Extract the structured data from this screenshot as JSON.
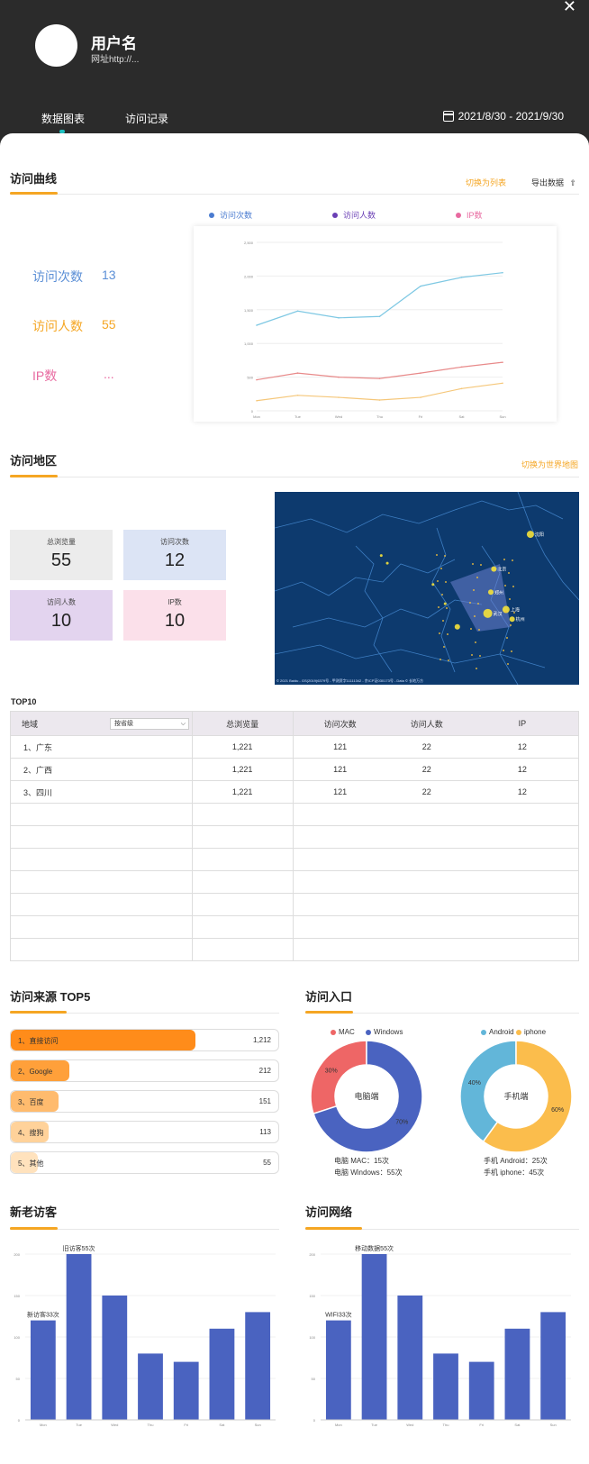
{
  "header": {
    "username": "用户名",
    "url": "网址http://...",
    "tabs": [
      "数据图表",
      "访问记录"
    ],
    "date_range": "2021/8/30 - 2021/9/30",
    "close": "✕"
  },
  "visit_curve": {
    "title": "访问曲线",
    "switch_link": "切换为列表",
    "export": "导出数据",
    "stats": [
      {
        "label": "访问次数",
        "value": "13",
        "color": "#5b8fd6"
      },
      {
        "label": "访问人数",
        "value": "55",
        "color": "#f5a623"
      },
      {
        "label": "IP数",
        "value": "...",
        "color": "#e86aa0"
      }
    ],
    "legend": [
      {
        "label": "访问次数",
        "color": "#4a7bd0"
      },
      {
        "label": "访问人数",
        "color": "#6a3fb5"
      },
      {
        "label": "IP数",
        "color": "#e86aa0"
      }
    ]
  },
  "chart_data": [
    {
      "type": "line",
      "categories": [
        "Mon",
        "Tue",
        "Wed",
        "Thu",
        "Fri",
        "Sat",
        "Sun"
      ],
      "ylim": [
        0,
        2500
      ],
      "yticks": [
        "0",
        "500",
        "1,000",
        "1,500",
        "2,000",
        "2,500"
      ],
      "series": [
        {
          "color": "#7ec8e3",
          "values": [
            1270,
            1480,
            1380,
            1400,
            1850,
            1980,
            2050
          ]
        },
        {
          "color": "#e88a8a",
          "values": [
            460,
            560,
            500,
            480,
            560,
            650,
            720
          ]
        },
        {
          "color": "#f5c77a",
          "values": [
            150,
            230,
            200,
            160,
            200,
            330,
            410
          ]
        }
      ]
    },
    {
      "type": "bar",
      "categories": [
        "Mon",
        "Tue",
        "Wed",
        "Thu",
        "Fri",
        "Sat",
        "Sun"
      ],
      "values": [
        120,
        200,
        150,
        80,
        70,
        110,
        130
      ],
      "ylim": [
        0,
        200
      ],
      "yticks": [
        "0",
        "50",
        "100",
        "150",
        "200"
      ],
      "annotations": [
        {
          "category": "Mon",
          "text": "新访客33次"
        },
        {
          "category": "Tue",
          "text": "旧访客55次"
        }
      ]
    },
    {
      "type": "bar",
      "categories": [
        "Mon",
        "Tue",
        "Wed",
        "Thu",
        "Fri",
        "Sat",
        "Sun"
      ],
      "values": [
        120,
        200,
        150,
        80,
        70,
        110,
        130
      ],
      "ylim": [
        0,
        200
      ],
      "yticks": [
        "0",
        "50",
        "100",
        "150",
        "200"
      ],
      "annotations": [
        {
          "category": "Mon",
          "text": "WIFI33次"
        },
        {
          "category": "Tue",
          "text": "移动数据55次"
        }
      ]
    },
    {
      "type": "pie",
      "title": "电脑端",
      "slices": [
        {
          "label": "MAC",
          "value": 30,
          "color": "#ee6666",
          "text": "30%"
        },
        {
          "label": "Windows",
          "value": 70,
          "color": "#4a63c0",
          "text": "70%"
        }
      ]
    },
    {
      "type": "pie",
      "title": "手机端",
      "slices": [
        {
          "label": "Android",
          "value": 40,
          "color": "#62b6d9",
          "text": "40%"
        },
        {
          "label": "iphone",
          "value": 60,
          "color": "#fbbd4c",
          "text": "60%"
        }
      ]
    }
  ],
  "region": {
    "title": "访问地区",
    "switch_link": "切换为世界地图",
    "cards": [
      {
        "label": "总浏览量",
        "value": "55",
        "color": "#ececec"
      },
      {
        "label": "访问次数",
        "value": "12",
        "color": "#dce4f5"
      },
      {
        "label": "访问人数",
        "value": "10",
        "color": "#e3d4ef"
      },
      {
        "label": "IP数",
        "value": "10",
        "color": "#fbe0ea"
      }
    ],
    "map_dots": [
      {
        "lon": 0.84,
        "lat": 0.22,
        "r": 4,
        "label": "沈阳"
      },
      {
        "lon": 0.72,
        "lat": 0.4,
        "r": 3,
        "label": "北京"
      },
      {
        "lon": 0.71,
        "lat": 0.52,
        "r": 3,
        "label": "郑州"
      },
      {
        "lon": 0.76,
        "lat": 0.61,
        "r": 4,
        "label": "上海"
      },
      {
        "lon": 0.7,
        "lat": 0.63,
        "r": 5,
        "label": "武汉"
      },
      {
        "lon": 0.78,
        "lat": 0.66,
        "r": 3,
        "label": "杭州"
      },
      {
        "lon": 0.6,
        "lat": 0.7,
        "r": 3,
        "label": ""
      },
      {
        "lon": 0.35,
        "lat": 0.33,
        "r": 1.5,
        "label": ""
      },
      {
        "lon": 0.37,
        "lat": 0.37,
        "r": 1.5,
        "label": ""
      },
      {
        "lon": 0.52,
        "lat": 0.48,
        "r": 1.5,
        "label": ""
      },
      {
        "lon": 0.56,
        "lat": 0.58,
        "r": 1.5,
        "label": ""
      }
    ],
    "map_footer": "© 2021 Baidu - GS(2019)6379号 - 甲测资字11111342 - 京ICP证030173号 - Data © 长地万方"
  },
  "top10": {
    "title": "TOP10",
    "select_value": "按省级",
    "headers": [
      "地域",
      "总浏览量",
      "访问次数",
      "访问人数",
      "IP"
    ],
    "rows": [
      [
        "1、广东",
        "1,221",
        "121",
        "22",
        "12"
      ],
      [
        "2、广西",
        "1,221",
        "121",
        "22",
        "12"
      ],
      [
        "3、四川",
        "1,221",
        "121",
        "22",
        "12"
      ]
    ],
    "empty_rows": 7
  },
  "sources": {
    "title": "访问来源 TOP5",
    "items": [
      {
        "label": "1、直接访问",
        "value": "1,212",
        "fill": 0.69,
        "color": "#ff8c1a"
      },
      {
        "label": "2、Google",
        "value": "212",
        "fill": 0.22,
        "color": "#ffa03a"
      },
      {
        "label": "3、百度",
        "value": "151",
        "fill": 0.18,
        "color": "#ffbb6e"
      },
      {
        "label": "4、搜狗",
        "value": "113",
        "fill": 0.14,
        "color": "#ffd29a"
      },
      {
        "label": "5、其他",
        "value": "55",
        "fill": 0.1,
        "color": "#ffe2bd"
      }
    ]
  },
  "entry": {
    "title": "访问入口",
    "pc_legend": [
      "MAC",
      "Windows"
    ],
    "mobile_legend": [
      "Android",
      "iphone"
    ],
    "pc_lines": [
      "电脑 MAC：15次",
      "电脑 Windows：55次"
    ],
    "mobile_lines": [
      "手机 Android：25次",
      "手机 iphone：45次"
    ]
  },
  "visitors": {
    "title": "新老访客"
  },
  "network": {
    "title": "访问网络"
  }
}
